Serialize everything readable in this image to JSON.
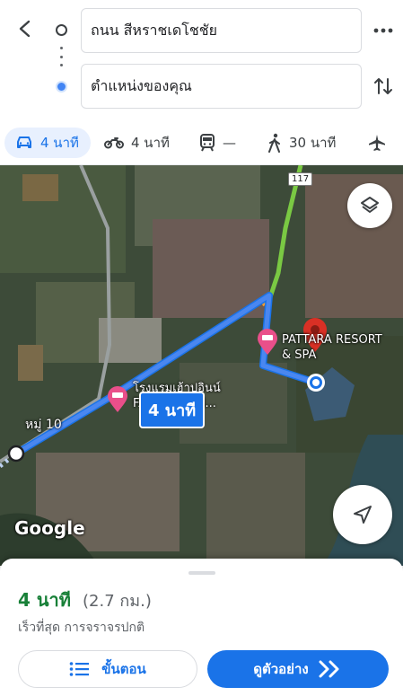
{
  "header": {
    "from": "ถนน สีหราชเดโชชัย",
    "to": "ตำแหน่งของคุณ"
  },
  "modes": {
    "car": "4 นาที",
    "bike": "4 นาที",
    "transit": "—",
    "walk": "30 นาที"
  },
  "map": {
    "route_time_label": "4 นาที",
    "road_number": "117",
    "place_1": "PATTARA RESORT & SPA",
    "place_2": "โรงแรมเฮ้าปอินน์ FAIRTOP INN...",
    "village": "หมู่ 10",
    "attribution": "Google",
    "route_color": "#4a87f0"
  },
  "summary": {
    "duration": "4 นาที",
    "distance": "(2.7 กม.)",
    "description": "เร็วที่สุด การจราจรปกติ",
    "steps_label": "ขั้นตอน",
    "preview_label": "ดูตัวอย่าง"
  }
}
